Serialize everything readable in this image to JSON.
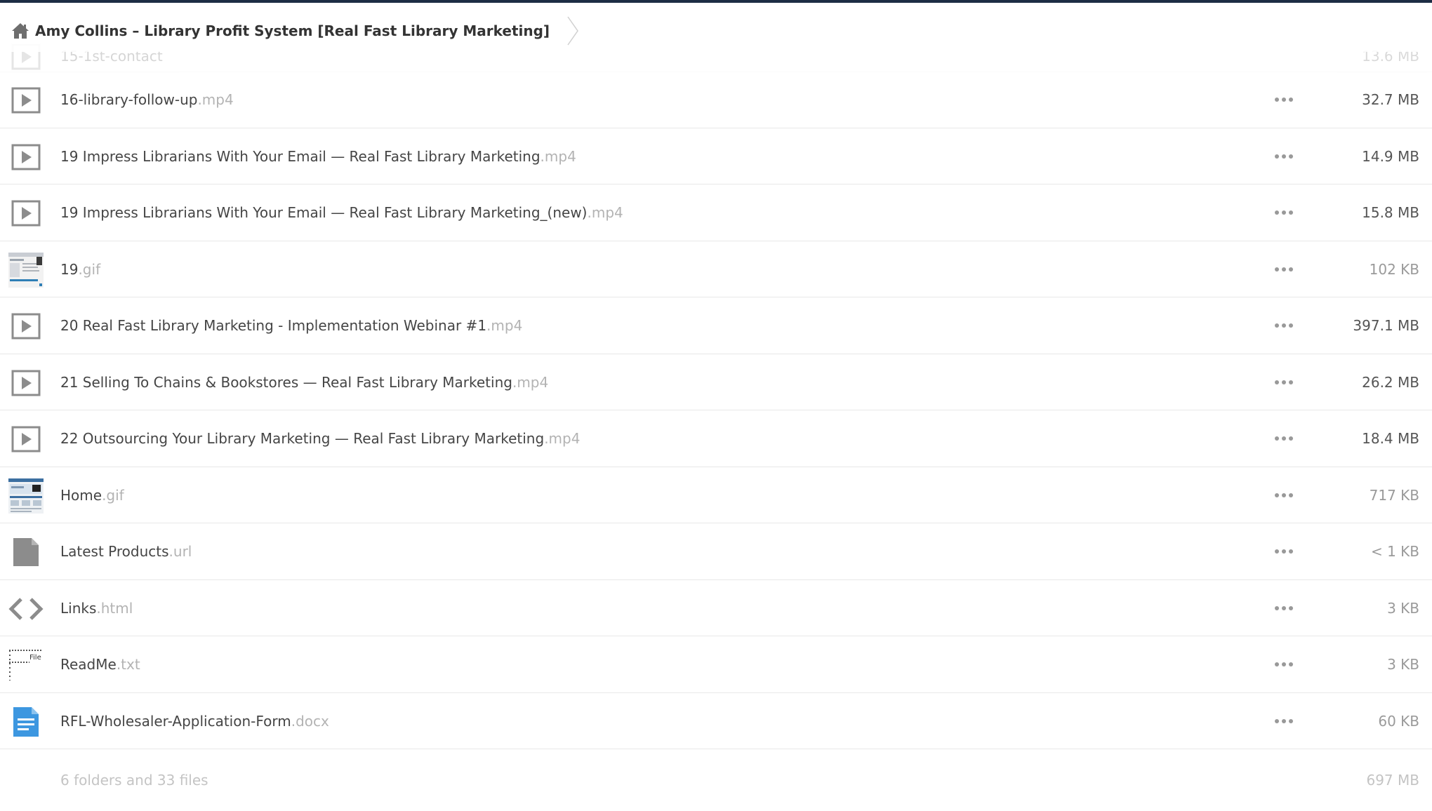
{
  "header": {
    "title": "Amy Collins – Library Profit System [Real Fast Library Marketing]"
  },
  "ghost_row": {
    "name": "15-1st-contact",
    "size": "13.6 MB"
  },
  "files": [
    {
      "name": "16-library-follow-up",
      "ext": ".mp4",
      "size": "32.7 MB",
      "icon": "video-file-icon"
    },
    {
      "name": "19 Impress Librarians With Your Email — Real Fast Library Marketing",
      "ext": ".mp4",
      "size": "14.9 MB",
      "icon": "video-file-icon"
    },
    {
      "name": "19 Impress Librarians With Your Email — Real Fast Library Marketing_(new)",
      "ext": ".mp4",
      "size": "15.8 MB",
      "icon": "video-file-icon"
    },
    {
      "name": "19",
      "ext": ".gif",
      "size": "102 KB",
      "icon": "image-thumbnail"
    },
    {
      "name": "20 Real Fast Library Marketing - Implementation Webinar #1",
      "ext": ".mp4",
      "size": "397.1 MB",
      "icon": "video-file-icon"
    },
    {
      "name": "21 Selling To Chains & Bookstores — Real Fast Library Marketing",
      "ext": ".mp4",
      "size": "26.2 MB",
      "icon": "video-file-icon"
    },
    {
      "name": "22 Outsourcing Your Library Marketing — Real Fast Library Marketing",
      "ext": ".mp4",
      "size": "18.4 MB",
      "icon": "video-file-icon"
    },
    {
      "name": "Home",
      "ext": ".gif",
      "size": "717 KB",
      "icon": "image-thumbnail"
    },
    {
      "name": "Latest Products",
      "ext": ".url",
      "size": "< 1 KB",
      "icon": "generic-file-icon"
    },
    {
      "name": "Links",
      "ext": ".html",
      "size": "3 KB",
      "icon": "code-file-icon"
    },
    {
      "name": "ReadMe",
      "ext": ".txt",
      "size": "3 KB",
      "icon": "text-file-thumbnail"
    },
    {
      "name": "RFL-Wholesaler-Application-Form",
      "ext": ".docx",
      "size": "60 KB",
      "icon": "document-file-icon"
    }
  ],
  "thumb_text": {
    "readme": "File I"
  },
  "footer": {
    "summary": "6 folders and 33 files",
    "total": "697 MB"
  },
  "colors": {
    "top_border": "#1d2d44",
    "icon_gray": "#8c8c8c",
    "doc_blue": "#3d97e0",
    "extension_gray": "#b3b3b3"
  }
}
